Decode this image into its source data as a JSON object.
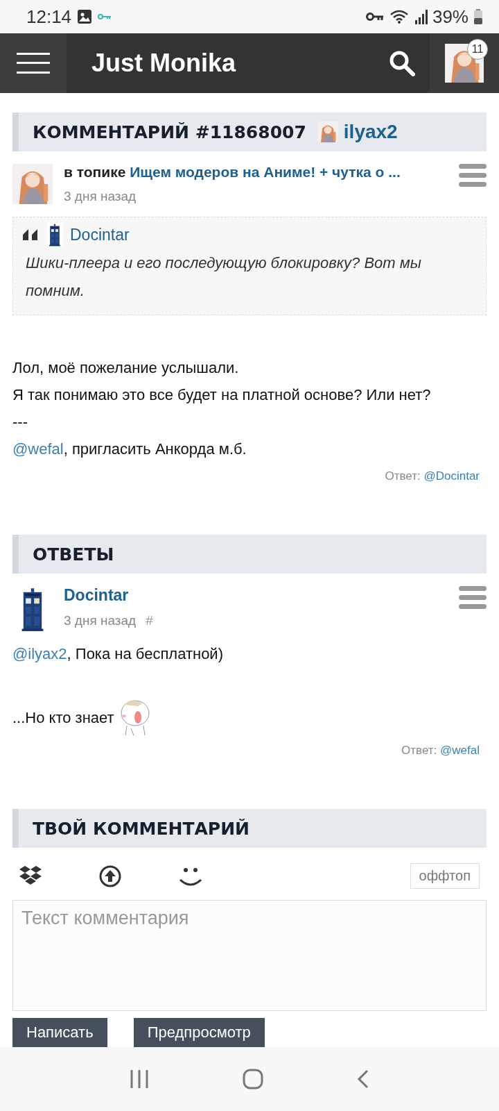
{
  "status_bar": {
    "time": "12:14",
    "battery": "39%"
  },
  "top_bar": {
    "title": "Just Monika",
    "badge": "11"
  },
  "comment": {
    "heading": "КОММЕНТАРИЙ #11868007",
    "author": "ilyax2",
    "topic_prefix": "в топике",
    "topic": "Ищем модеров на Аниме! + чутка о ...",
    "time": "3 дня назад",
    "quote": {
      "author": "Docintar",
      "text": "Шики-плеера и его последующую блокировку? Вот мы помним."
    },
    "lines": [
      {
        "text": "Лол, моё пожелание услышали."
      },
      {
        "text": "Я так понимаю это все будет на платной основе? Или нет?"
      },
      {
        "text": "---"
      },
      {
        "mention": "@wefal",
        "text": ", пригласить Анкорда м.б."
      }
    ],
    "reply_label": "Ответ:",
    "reply_to": "@Docintar"
  },
  "replies": {
    "heading": "ОТВЕТЫ",
    "items": [
      {
        "author": "Docintar",
        "time": "3 дня назад",
        "anchor": "#",
        "lines": [
          {
            "mention": "@ilyax2",
            "text": ", Пока на бесплатной)",
            "sticker": false
          },
          {
            "text": "...Но кто знает",
            "sticker": true
          }
        ],
        "reply_label": "Ответ:",
        "reply_to": "@wefal"
      }
    ]
  },
  "compose": {
    "heading": "ТВОЙ КОММЕНТАРИЙ",
    "offtop": "оффтоп",
    "placeholder": "Текст комментария",
    "buttons": [
      "Написать",
      "Предпросмотр"
    ]
  }
}
